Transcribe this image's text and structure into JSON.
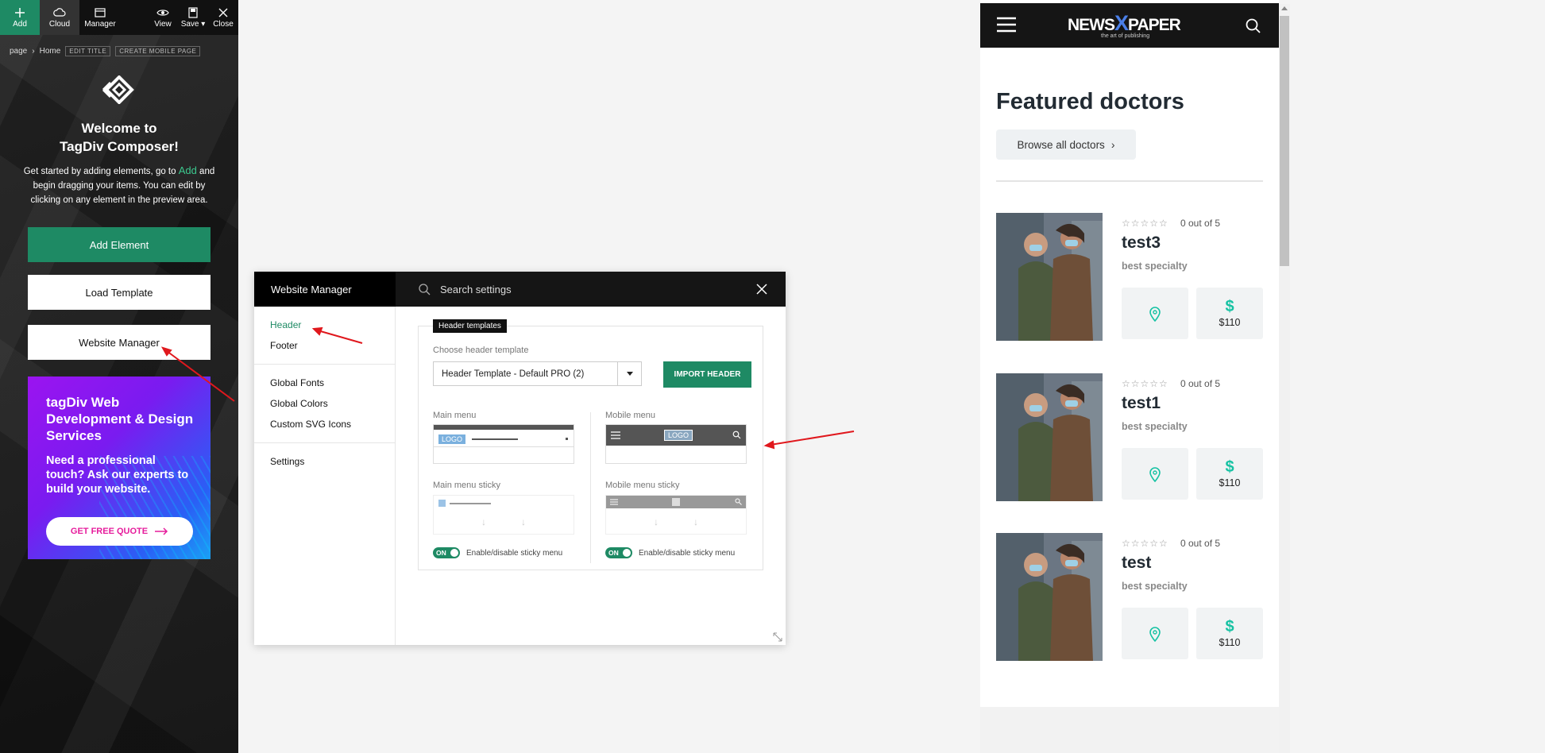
{
  "toolbar": {
    "add": "Add",
    "cloud": "Cloud",
    "manager": "Manager",
    "view": "View",
    "save": "Save",
    "close": "Close"
  },
  "breadcrumb": {
    "page": "page",
    "sep": "›",
    "home": "Home",
    "edit_title": "EDIT TITLE",
    "create_mobile": "CREATE MOBILE PAGE"
  },
  "welcome": {
    "title_line1": "Welcome to",
    "title_line2": "TagDiv Composer!",
    "intro_pre": "Get started by adding elements, go to ",
    "intro_add": "Add",
    "intro_post": " and begin dragging your items. You can edit by clicking on any element in the preview area."
  },
  "left_buttons": {
    "add_element": "Add Element",
    "load_template": "Load Template",
    "website_manager": "Website Manager"
  },
  "promo": {
    "title": "tagDiv Web Development & Design Services",
    "subtitle": "Need a professional touch? Ask our experts to build your website.",
    "cta": "GET FREE QUOTE"
  },
  "dialog": {
    "title": "Website Manager",
    "search_placeholder": "Search settings",
    "sidebar": {
      "header": "Header",
      "footer": "Footer",
      "global_fonts": "Global Fonts",
      "global_colors": "Global Colors",
      "custom_svg_icons": "Custom SVG Icons",
      "settings": "Settings"
    },
    "templates": {
      "tag": "Header templates",
      "choose_label": "Choose header template",
      "selected": "Header Template - Default PRO (2)",
      "import_button": "IMPORT HEADER",
      "main_menu": "Main menu",
      "mobile_menu": "Mobile menu",
      "main_menu_sticky": "Main menu sticky",
      "mobile_menu_sticky": "Mobile menu sticky",
      "logo": "LOGO",
      "toggle_on": "ON",
      "toggle_label": "Enable/disable sticky menu"
    }
  },
  "preview": {
    "brand_left": "NEWS",
    "brand_x": "X",
    "brand_right": "PAPER",
    "brand_tagline": "the art of publishing",
    "title": "Featured doctors",
    "browse": "Browse all doctors",
    "doctors": [
      {
        "name": "test3",
        "rating": "0 out of 5",
        "specialty": "best specialty",
        "price": "$110"
      },
      {
        "name": "test1",
        "rating": "0 out of 5",
        "specialty": "best specialty",
        "price": "$110"
      },
      {
        "name": "test",
        "rating": "0 out of 5",
        "specialty": "best specialty",
        "price": "$110"
      }
    ]
  },
  "colors": {
    "accent": "#1e8a64",
    "teal": "#16c2a3",
    "annotation": "#e0181d"
  }
}
